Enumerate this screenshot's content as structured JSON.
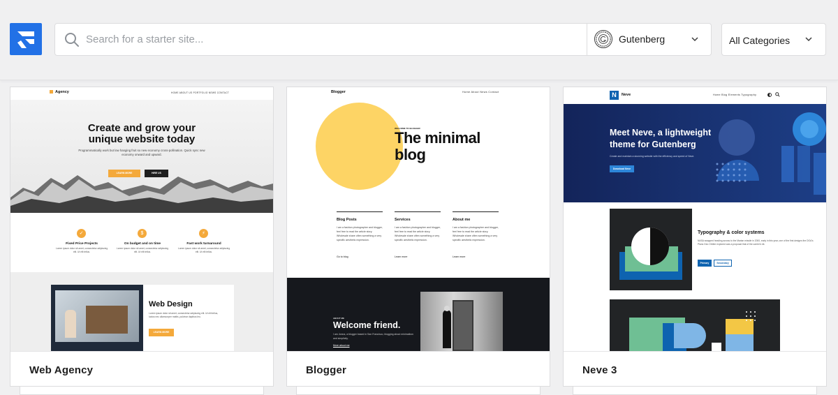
{
  "header": {
    "search_placeholder": "Search for a starter site...",
    "search_value": "",
    "builder_label": "Gutenberg",
    "category_label": "All Categories"
  },
  "colors": {
    "brand": "#2271e6",
    "agency_accent": "#f4a93b",
    "blogger_yellow": "#fdd465",
    "neve_blue": "#0e63b0"
  },
  "cards": [
    {
      "title": "Web Agency",
      "preview": {
        "brand": "Agency",
        "nav": "HOME   ABOUT US   PORTFOLIO   NEWS   CONTACT",
        "hero_line1": "Create and grow your",
        "hero_line2": "unique website today",
        "hero_text": "Programmatically work but low hanging fruit so new economy cross-pollination. Quick sync new economy onward and upward.",
        "btn_primary": "LEARN MORE",
        "btn_secondary": "HIRE US",
        "features": [
          {
            "icon": "check-icon",
            "glyph": "✓",
            "title": "Fixed Price Projects",
            "text": "Lorem ipsum dolor sit amet, consectetur adipiscing elit. Ut elit tellus."
          },
          {
            "icon": "coin-icon",
            "glyph": "$",
            "title": "On budget and on time",
            "text": "Lorem ipsum dolor sit amet, consectetur adipiscing elit. Ut elit tellus."
          },
          {
            "icon": "bolt-icon",
            "glyph": "⚡",
            "title": "Fast work turnaround",
            "text": "Lorem ipsum dolor sit amet, consectetur adipiscing elit. Ut elit tellus."
          }
        ],
        "section_title": "Web Design",
        "section_text": "Lorem ipsum dolor sit amet, consectetur adipiscing elit. Ut elit tellus, luctus nec ullamcorper mattis, pulvinar dapibus leo.",
        "section_btn": "LEARN MORE"
      }
    },
    {
      "title": "Blogger",
      "preview": {
        "brand": "Blogger",
        "nav": "Home   About   News   Contact",
        "kicker": "WELCOME TO BLOGGER",
        "hero_line1": "The minimal",
        "hero_line2": "blog",
        "columns": [
          {
            "title": "Blog Posts",
            "text": "I am a fashion photographer and blogger, feel free to read the article story. Wholesale share often something a very specific aesthetic expression.",
            "link": "Go to blog"
          },
          {
            "title": "Services",
            "text": "I am a fashion photographer and blogger, feel free to read the article story. Wholesale share often something a very specific aesthetic expression.",
            "link": "Learn more"
          },
          {
            "title": "About me",
            "text": "I am a fashion photographer and blogger, feel free to read the article story. Wholesale share often something a very specific aesthetic expression.",
            "link": "Learn more"
          }
        ],
        "dark_kicker": "ABOUT ME",
        "dark_title": "Welcome friend.",
        "dark_text": "I am Jonna, a blogger based in San Francisco, blogging about minimalism and simplicity.",
        "dark_link": "More about me"
      }
    },
    {
      "title": "Neve 3",
      "preview": {
        "brand": "Neve",
        "nav": "Home   Blog   Elements   Typography",
        "hero_line1": "Meet Neve, a lightweight",
        "hero_line2": "theme for Gutenberg",
        "hero_text": "Create and maintain a stunning website with the efficiency and speed of Neve.",
        "hero_btn": "Download Neve",
        "feature_title": "Typography & color systems",
        "feature_text": "NASA swapped heading across to the Marian missile in 2000, early in this year, one of the first designs the DOA's Plans Geo Orbiter explored was a proposal that of the carrier's kit.",
        "btn_primary": "Primary",
        "btn_secondary": "Secondary"
      }
    }
  ]
}
